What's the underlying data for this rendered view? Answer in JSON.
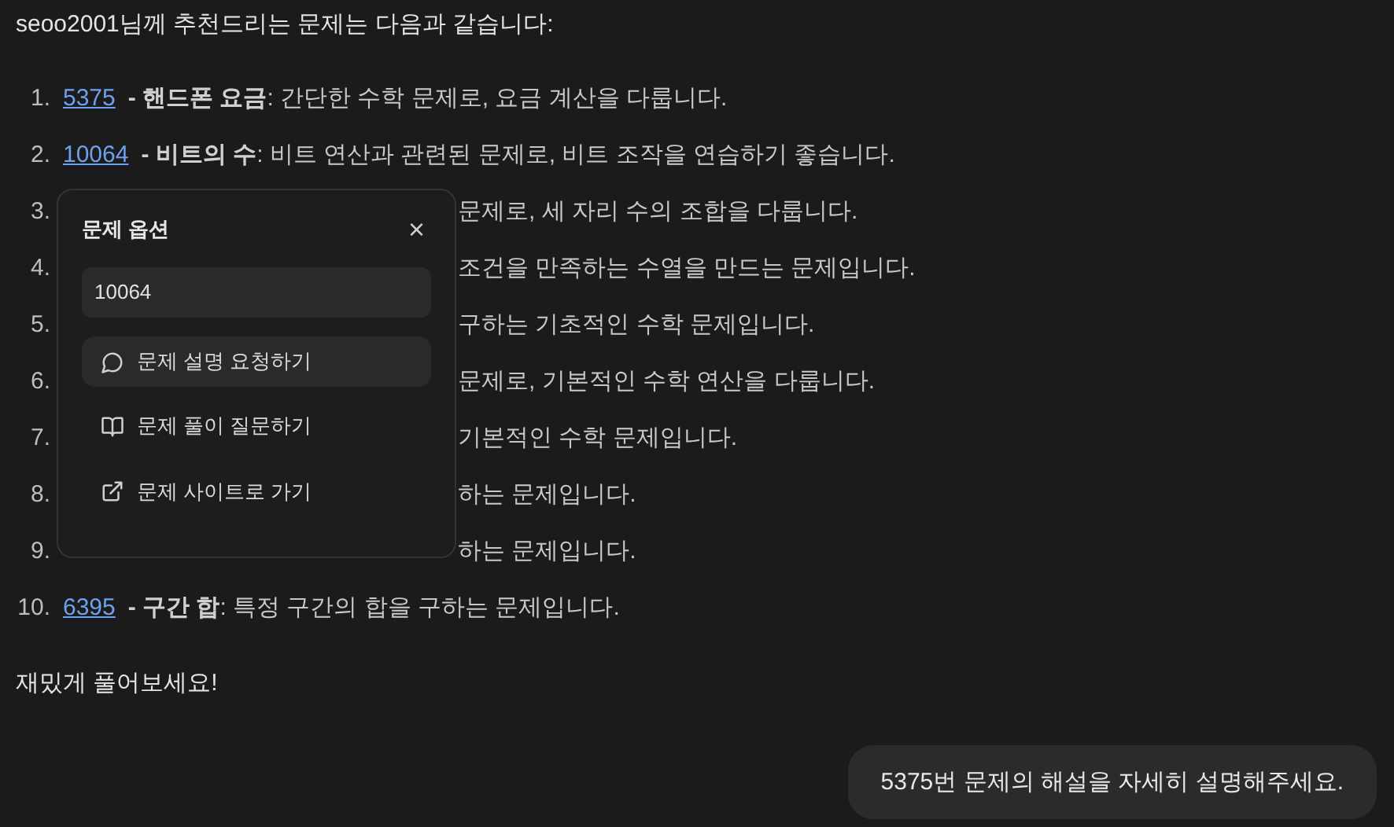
{
  "intro": "seoo2001님께 추천드리는 문제는 다음과 같습니다:",
  "problems": [
    {
      "kind": "full",
      "number": "1.",
      "id": "5375",
      "title": "- 핸드폰 요금",
      "desc": ": 간단한 수학 문제로, 요금 계산을 다룹니다."
    },
    {
      "kind": "full",
      "number": "2.",
      "id": "10064",
      "title": "- 비트의 수",
      "desc": ": 비트 연산과 관련된 문제로, 비트 조작을 연습하기 좋습니다."
    },
    {
      "kind": "covered",
      "number": "3.",
      "desc": "문제로, 세 자리 수의 조합을 다룹니다."
    },
    {
      "kind": "covered",
      "number": "4.",
      "desc": "조건을 만족하는 수열을 만드는 문제입니다."
    },
    {
      "kind": "covered",
      "number": "5.",
      "desc": "구하는 기초적인 수학 문제입니다."
    },
    {
      "kind": "covered",
      "number": "6.",
      "desc": "문제로, 기본적인 수학 연산을 다룹니다."
    },
    {
      "kind": "covered",
      "number": "7.",
      "desc": "기본적인 수학 문제입니다."
    },
    {
      "kind": "covered",
      "number": "8.",
      "desc": "하는 문제입니다."
    },
    {
      "kind": "covered",
      "number": "9.",
      "desc": "하는 문제입니다."
    },
    {
      "kind": "full",
      "number": "10.",
      "id": "6395",
      "title": "- 구간 합",
      "desc": ": 특정 구간의 합을 구하는 문제입니다."
    }
  ],
  "outro": "재밌게 풀어보세요!",
  "popup": {
    "title": "문제 옵션",
    "close": "×",
    "field_value": "10064",
    "options": [
      {
        "kind": "chat",
        "label": "문제 설명 요청하기",
        "selected": true
      },
      {
        "kind": "book",
        "label": "문제 풀이 질문하기",
        "selected": false
      },
      {
        "kind": "external",
        "label": "문제 사이트로 가기",
        "selected": false
      }
    ]
  },
  "user_message": "5375번 문제의 해설을 자세히 설명해주세요."
}
